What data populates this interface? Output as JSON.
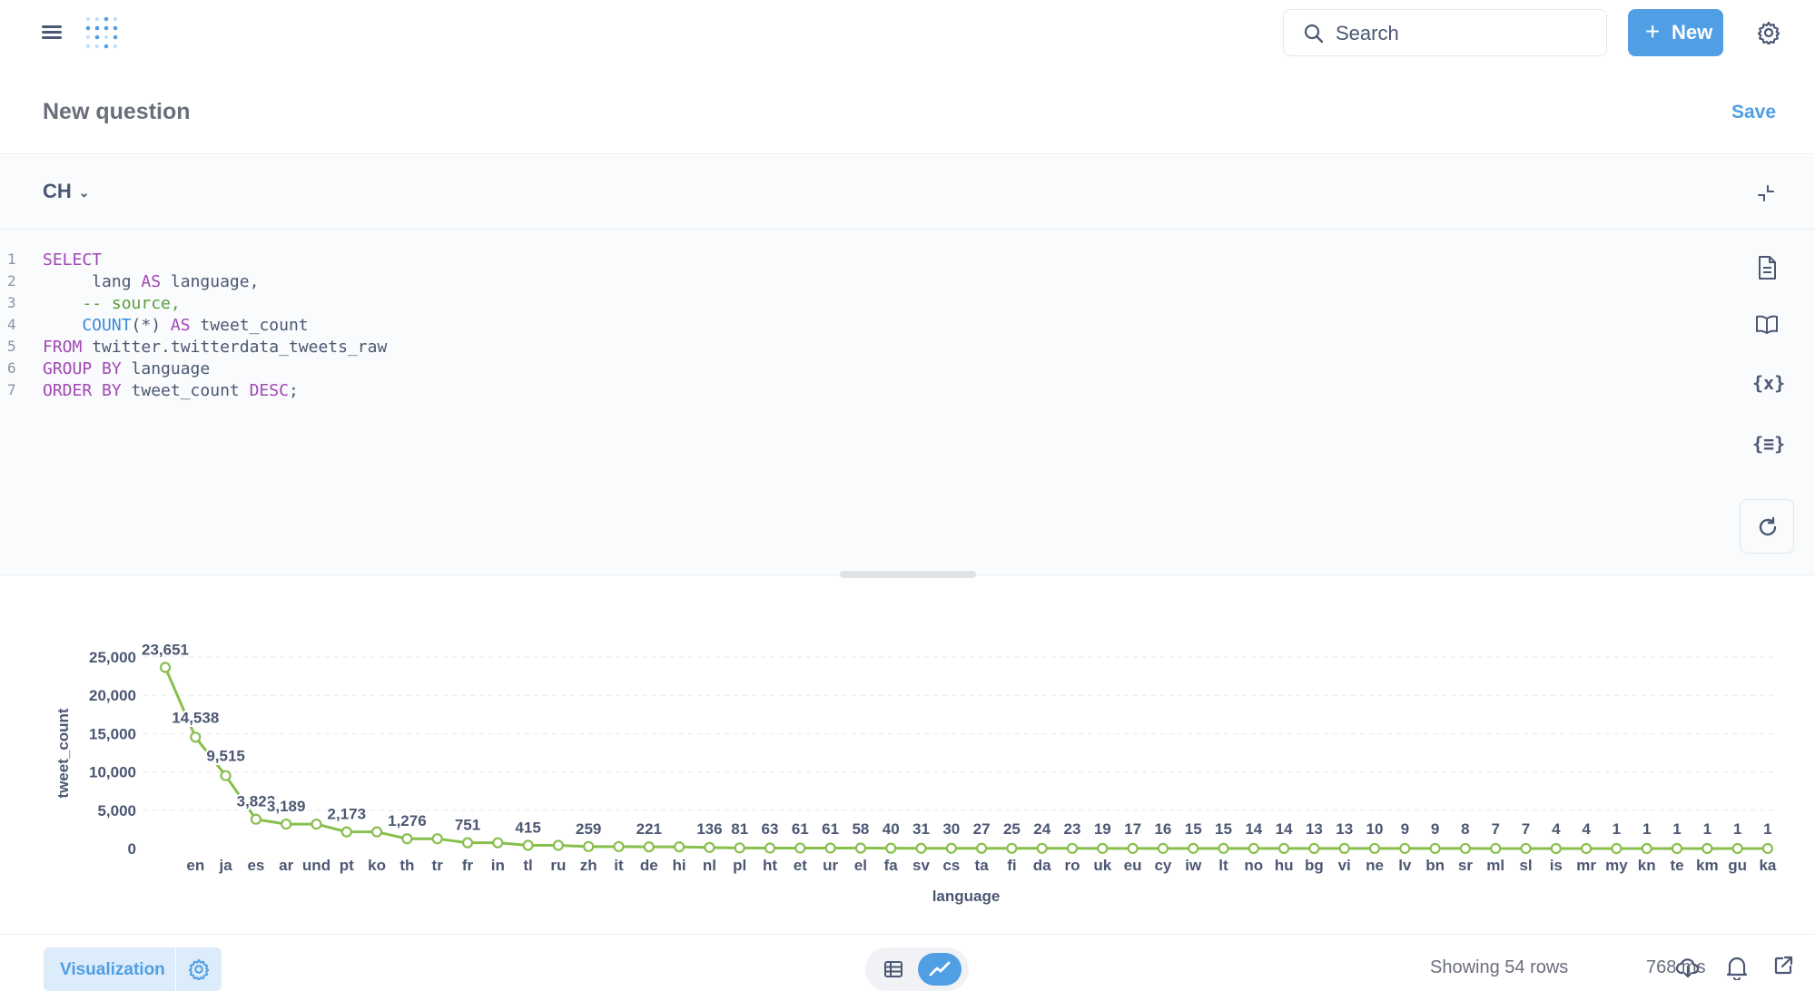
{
  "nav": {
    "search_placeholder": "Search",
    "new_label": "New"
  },
  "header": {
    "title": "New question",
    "save_label": "Save"
  },
  "database": {
    "selected": "CH"
  },
  "editor": {
    "lines": [
      {
        "num": "1",
        "segments": [
          {
            "t": "kw",
            "v": "SELECT"
          }
        ]
      },
      {
        "num": "2",
        "segments": [
          {
            "t": "txt",
            "v": "     lang "
          },
          {
            "t": "kw",
            "v": "AS"
          },
          {
            "t": "txt",
            "v": " language,"
          }
        ]
      },
      {
        "num": "3",
        "segments": [
          {
            "t": "cm",
            "v": "    -- source,"
          }
        ]
      },
      {
        "num": "4",
        "segments": [
          {
            "t": "fn",
            "v": "    COUNT"
          },
          {
            "t": "txt",
            "v": "(*) "
          },
          {
            "t": "kw",
            "v": "AS"
          },
          {
            "t": "txt",
            "v": " tweet_count"
          }
        ]
      },
      {
        "num": "5",
        "segments": [
          {
            "t": "kw",
            "v": "FROM"
          },
          {
            "t": "txt",
            "v": " twitter.twitterdata_tweets_raw"
          }
        ]
      },
      {
        "num": "6",
        "segments": [
          {
            "t": "kw",
            "v": "GROUP BY"
          },
          {
            "t": "txt",
            "v": " language "
          }
        ]
      },
      {
        "num": "7",
        "segments": [
          {
            "t": "kw",
            "v": "ORDER BY"
          },
          {
            "t": "txt",
            "v": " tweet_count "
          },
          {
            "t": "kw",
            "v": "DESC"
          },
          {
            "t": "txt",
            "v": ";"
          }
        ]
      }
    ],
    "variables_icon_text": "{x}",
    "snippets_icon_text": "{≡}"
  },
  "chart_data": {
    "type": "line",
    "xlabel": "language",
    "ylabel": "tweet_count",
    "ylim": [
      0,
      25000
    ],
    "yticks": [
      "0",
      "5,000",
      "10,000",
      "15,000",
      "20,000",
      "25,000"
    ],
    "ytick_values": [
      0,
      5000,
      10000,
      15000,
      20000,
      25000
    ],
    "color": "#88bf4d",
    "categories": [
      "en",
      "ja",
      "es",
      "ar",
      "und",
      "pt",
      "ko",
      "th",
      "tr",
      "fr",
      "in",
      "tl",
      "ru",
      "zh",
      "it",
      "de",
      "hi",
      "nl",
      "pl",
      "ht",
      "et",
      "ur",
      "el",
      "fa",
      "sv",
      "cs",
      "ta",
      "fi",
      "da",
      "ro",
      "uk",
      "eu",
      "cy",
      "iw",
      "lt",
      "no",
      "hu",
      "bg",
      "vi",
      "ne",
      "lv",
      "bn",
      "sr",
      "ml",
      "sl",
      "is",
      "mr",
      "my",
      "kn",
      "te",
      "km",
      "gu",
      "ka"
    ],
    "values": [
      23651,
      14538,
      9515,
      3823,
      3189,
      3189,
      2173,
      2173,
      1276,
      1276,
      751,
      751,
      415,
      415,
      259,
      259,
      221,
      221,
      136,
      81,
      63,
      61,
      61,
      58,
      40,
      31,
      30,
      27,
      25,
      24,
      23,
      19,
      17,
      16,
      15,
      15,
      14,
      14,
      13,
      13,
      10,
      9,
      9,
      8,
      7,
      7,
      4,
      4,
      1,
      1,
      1,
      1,
      1,
      1
    ],
    "data_labels": [
      "23,651",
      "14,538",
      "9,515",
      "3,823",
      "3,189",
      "",
      "2,173",
      "",
      "1,276",
      "",
      "751",
      "",
      "415",
      "",
      "259",
      "",
      "221",
      "",
      "136",
      "81",
      "63",
      "61",
      "61",
      "58",
      "40",
      "31",
      "30",
      "27",
      "25",
      "24",
      "23",
      "19",
      "17",
      "16",
      "15",
      "15",
      "14",
      "14",
      "13",
      "13",
      "10",
      "9",
      "9",
      "8",
      "7",
      "7",
      "4",
      "4",
      "1",
      "1",
      "1",
      "1",
      "1",
      "1"
    ],
    "x_positions_note": ""
  },
  "footer": {
    "visualization_label": "Visualization",
    "row_count": "Showing 54 rows",
    "timing": "768 ms"
  }
}
